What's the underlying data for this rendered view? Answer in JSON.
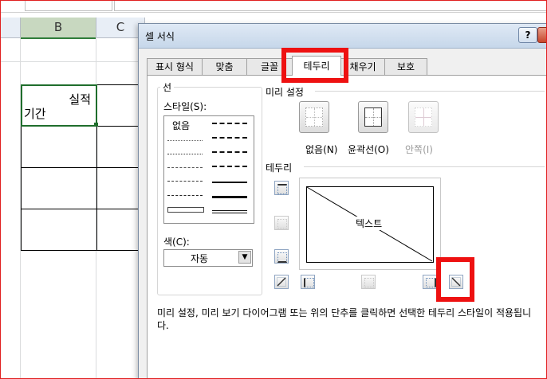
{
  "spreadsheet": {
    "columns": [
      {
        "label": "B",
        "selected": true
      },
      {
        "label": "C",
        "selected": false
      }
    ],
    "cell_b1_text_top": "실적",
    "cell_b1_text_bottom": "기간"
  },
  "dialog": {
    "title": "셀 서식",
    "help_label": "?",
    "tabs": [
      {
        "label": "표시 형식",
        "active": false
      },
      {
        "label": "맞춤",
        "active": false
      },
      {
        "label": "글꼴",
        "active": false
      },
      {
        "label": "테두리",
        "active": true
      },
      {
        "label": "채우기",
        "active": false
      },
      {
        "label": "보호",
        "active": false
      }
    ],
    "line_group_label": "선",
    "style_label": "스타일(S):",
    "style_none": "없음",
    "color_label": "색(C):",
    "color_value": "자동",
    "presets_label": "미리 설정",
    "presets": [
      {
        "label": "없음(N)",
        "enabled": true
      },
      {
        "label": "윤곽선(O)",
        "enabled": true
      },
      {
        "label": "안쪽(I)",
        "enabled": false
      }
    ],
    "border_label": "테두리",
    "preview_text": "텍스트",
    "description": "미리 설정, 미리 보기 다이어그램 또는 위의 단추를 클릭하면 선택한 테두리 스타일이 적용됩니다."
  },
  "colors": {
    "highlight": "#ee1111",
    "selection_green": "#1f6e2c",
    "titlebar": "#c6d7ea"
  }
}
